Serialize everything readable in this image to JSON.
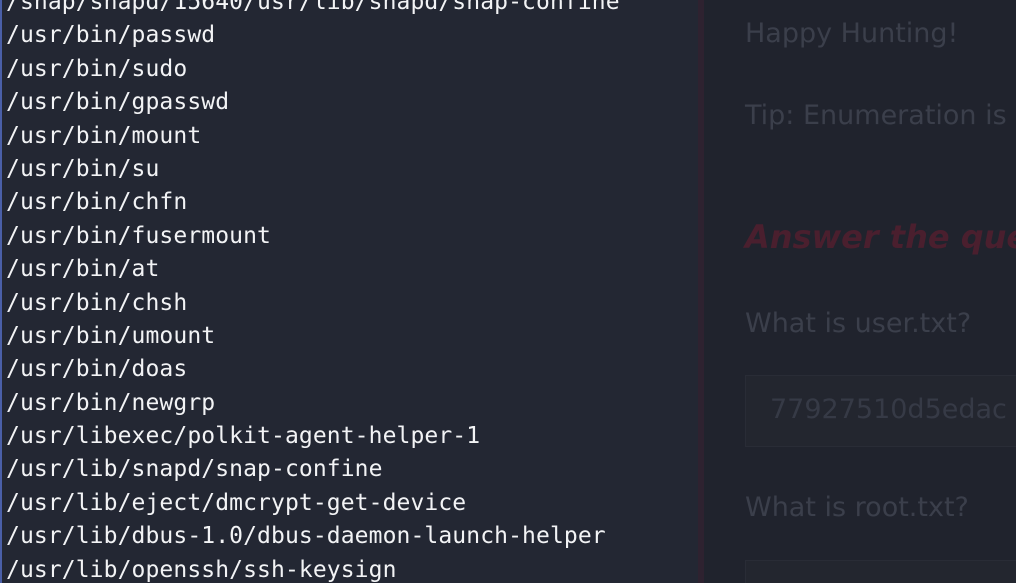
{
  "terminal": {
    "lines": [
      "/snap/snapd/15640/usr/lib/snapd/snap-confine",
      "/usr/bin/passwd",
      "/usr/bin/sudo",
      "/usr/bin/gpasswd",
      "/usr/bin/mount",
      "/usr/bin/su",
      "/usr/bin/chfn",
      "/usr/bin/fusermount",
      "/usr/bin/at",
      "/usr/bin/chsh",
      "/usr/bin/umount",
      "/usr/bin/doas",
      "/usr/bin/newgrp",
      "/usr/libexec/polkit-agent-helper-1",
      "/usr/lib/snapd/snap-confine",
      "/usr/lib/eject/dmcrypt-get-device",
      "/usr/lib/dbus-1.0/dbus-daemon-launch-helper",
      "/usr/lib/openssh/ssh-keysign"
    ]
  },
  "webpage": {
    "greeting": "Happy Hunting!",
    "tip": "Tip: Enumeration is",
    "section_heading": "Answer the que",
    "question_user": "What is user.txt?",
    "answer_user": "77927510d5edac",
    "question_root": "What is root.txt?",
    "answer_root": ""
  }
}
